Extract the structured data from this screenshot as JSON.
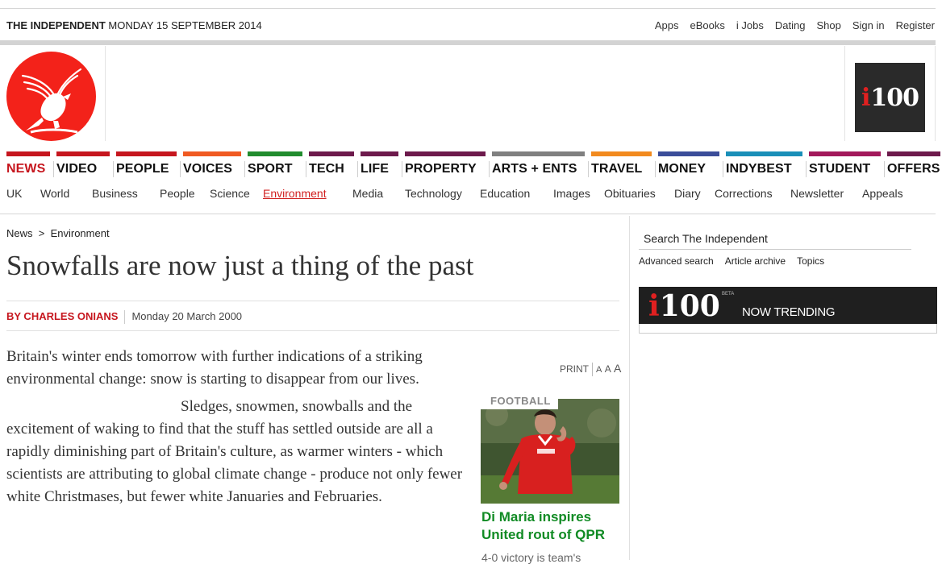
{
  "masthead": {
    "brand": "THE INDEPENDENT",
    "date": "MONDAY 15 SEPTEMBER 2014"
  },
  "top_links": [
    "Apps",
    "eBooks",
    "i Jobs",
    "Dating",
    "Shop",
    "Sign in",
    "Register"
  ],
  "promo_logo": {
    "i": "i",
    "num": "100"
  },
  "nav": [
    {
      "label": "NEWS",
      "color": "#c6161e",
      "active": true
    },
    {
      "label": "VIDEO",
      "color": "#c6161e"
    },
    {
      "label": "PEOPLE",
      "color": "#c6161e"
    },
    {
      "label": "VOICES",
      "color": "#f05a22"
    },
    {
      "label": "SPORT",
      "color": "#218c2e"
    },
    {
      "label": "TECH",
      "color": "#6d1a4c"
    },
    {
      "label": "LIFE",
      "color": "#6d1a4c"
    },
    {
      "label": "PROPERTY",
      "color": "#6d1a4c"
    },
    {
      "label": "ARTS + ENTS",
      "color": "#808080"
    },
    {
      "label": "TRAVEL",
      "color": "#f28a1e"
    },
    {
      "label": "MONEY",
      "color": "#3b4d99"
    },
    {
      "label": "INDYBEST",
      "color": "#1a8fb8"
    },
    {
      "label": "STUDENT",
      "color": "#a3195b"
    },
    {
      "label": "OFFERS",
      "color": "#6d1a4c"
    }
  ],
  "subnav": [
    {
      "label": "UK"
    },
    {
      "label": "World"
    },
    {
      "label": "Business"
    },
    {
      "label": "People"
    },
    {
      "label": "Science"
    },
    {
      "label": "Environment",
      "active": true
    },
    {
      "label": "Media"
    },
    {
      "label": "Technology"
    },
    {
      "label": "Education"
    },
    {
      "label": "Images"
    },
    {
      "label": "Obituaries"
    },
    {
      "label": "Diary"
    },
    {
      "label": "Corrections"
    },
    {
      "label": "Newsletter"
    },
    {
      "label": "Appeals"
    }
  ],
  "breadcrumb": {
    "root": "News",
    "sep": ">",
    "section": "Environment"
  },
  "article": {
    "headline": "Snowfalls are now just a thing of the past",
    "author": "BY CHARLES ONIANS",
    "date": "Monday 20 March 2000",
    "para1": "Britain's winter ends tomorrow with further indications of a striking environmental change: snow is starting to disappear from our lives.",
    "para2": "Sledges, snowmen, snowballs and the excitement of waking to find that the stuff has settled outside are all a rapidly diminishing part of Britain's culture, as warmer winters - which scientists are attributing to global climate change - produce not only fewer white Christmases, but fewer white Januaries and Februaries."
  },
  "tools": {
    "print": "PRINT",
    "a_small": "A",
    "a_mid": "A",
    "a_large": "A"
  },
  "promo": {
    "tag": "FOOTBALL",
    "title": "Di Maria inspires United rout of QPR",
    "snippet": "4-0 victory is team's"
  },
  "sidebar": {
    "search_placeholder": "Search The Independent",
    "links": [
      "Advanced search",
      "Article archive",
      "Topics"
    ],
    "trending_logo_i": "i",
    "trending_logo_num": "100",
    "trending_beta": "BETA",
    "trending_label": "NOW TRENDING"
  },
  "colors": {
    "brand_red": "#f3221a",
    "link_red": "#c6161e",
    "promo_green": "#118b24"
  }
}
